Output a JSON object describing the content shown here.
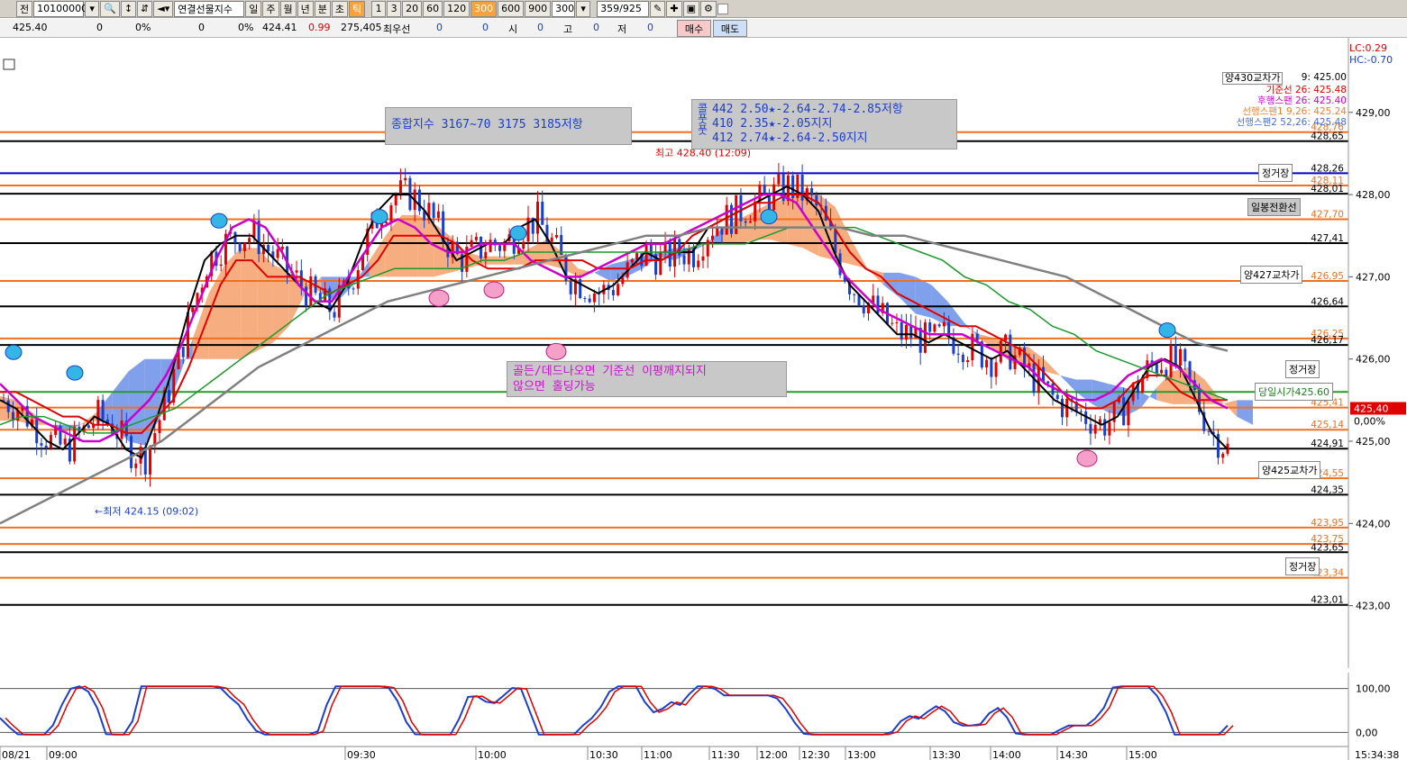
{
  "toolbar": {
    "code_label": "전",
    "code_value": "10100000",
    "product_name": "연결선물지수",
    "period_buttons": [
      "일",
      "주",
      "월",
      "년",
      "분",
      "초",
      "틱"
    ],
    "active_period": "틱",
    "interval_buttons": [
      "1",
      "3",
      "20",
      "60",
      "120",
      "300",
      "600",
      "900"
    ],
    "active_interval": "300",
    "interval_value": "300",
    "page_counter": "359/925"
  },
  "info": {
    "price": "425.40",
    "v1": "0",
    "p1": "0%",
    "v2": "0",
    "p2": "0%",
    "v3": "424.41",
    "v4": "0.99",
    "volume": "275,405",
    "best_label": "최우선",
    "best_v1": "0",
    "best_v2": "0",
    "open_label": "시",
    "open_value": "0",
    "high_label": "고",
    "high_value": "0",
    "low_label": "저",
    "low_value": "0",
    "buy_label": "매수",
    "sell_label": "매도"
  },
  "corner": {
    "lc": "LC:0.29",
    "hc": "HC:-0.70"
  },
  "legend": {
    "title": "양430교차가",
    "items": [
      {
        "label": "9:",
        "value": "425.00",
        "color": "#000000"
      },
      {
        "label": "기준선 26:",
        "value": "425.48",
        "color": "#e00000"
      },
      {
        "label": "후행스팬 26:",
        "value": "425.40",
        "color": "#cc00cc"
      },
      {
        "label": "선행스팬1 9,26:",
        "value": "425.24",
        "color": "#f08030"
      },
      {
        "label": "선행스팬2 52,26:",
        "value": "425.48",
        "color": "#4a6fd8"
      }
    ]
  },
  "annotations": {
    "kospi": "종합지수 3167~70 3175 3185저항",
    "options_side": "콜풋풋",
    "options": [
      "442 2.50★-2.64-2.74-2.85저항",
      "410 2.35★-2.05지지",
      "412 2.74★-2.64-2.50지지"
    ],
    "cross_note": [
      "골든/데드나오면 기준선 이평깨지되지",
      "않으면 홀딩가능"
    ],
    "high_mark": "최고 428.40 (12:09)",
    "low_mark": "←최저 424.15 (09:02)"
  },
  "level_labels": {
    "jeong1": "정거장",
    "ilbong": "일봉전환선",
    "yang427": "양427교차가",
    "jeong2": "정거장",
    "dangil": "당일시가425.60",
    "yang425": "양425교차가",
    "jeong3": "정거장"
  },
  "colors": {
    "candle_up": "#e00000",
    "candle_down": "#1a3fd0",
    "tenkan": "#000000",
    "kijun": "#e00000",
    "chikou": "#cc00cc",
    "span1": "#f08030",
    "span2": "#4a6fd8",
    "ma_green": "#1a9a2a",
    "ma_gray": "#808080",
    "level_orange": "#f07020",
    "level_black": "#000000",
    "level_blue": "#0000cc",
    "level_green": "#2a9a2a"
  },
  "chart_data": {
    "type": "candlestick",
    "title": "연결선물지수",
    "ylim": [
      422.7,
      429.6
    ],
    "yticks": [
      423.0,
      424.0,
      425.0,
      426.0,
      427.0,
      428.0,
      429.0
    ],
    "ytick_labels": [
      "423,00",
      "424,00",
      "425,00",
      "426,00",
      "427,00",
      "428,00",
      "429,00"
    ],
    "xticks": [
      "08/21",
      "09:00",
      "09:30",
      "10:00",
      "10:30",
      "11:00",
      "11:30",
      "12:00",
      "12:30",
      "13:00",
      "13:30",
      "14:00",
      "14:30",
      "15:00"
    ],
    "time_label": "15:34:38",
    "pct_label": "0,00%",
    "current_price": 425.4,
    "current_price_label": "425,40",
    "high": 428.4,
    "low": 424.15,
    "levels": [
      {
        "price": 428.76,
        "label": "428,76",
        "color": "orange"
      },
      {
        "price": 428.65,
        "label": "428,65",
        "color": "black"
      },
      {
        "price": 428.26,
        "label": "428,26",
        "color": "blue"
      },
      {
        "price": 428.11,
        "label": "428,11",
        "color": "orange"
      },
      {
        "price": 428.01,
        "label": "428,01",
        "color": "black"
      },
      {
        "price": 427.7,
        "label": "427,70",
        "color": "orange"
      },
      {
        "price": 427.41,
        "label": "427,41",
        "color": "black"
      },
      {
        "price": 426.95,
        "label": "426,95",
        "color": "orange"
      },
      {
        "price": 426.64,
        "label": "426,64",
        "color": "black"
      },
      {
        "price": 426.25,
        "label": "426,25",
        "color": "orange"
      },
      {
        "price": 426.17,
        "label": "426,17",
        "color": "black"
      },
      {
        "price": 425.6,
        "label": "",
        "color": "green"
      },
      {
        "price": 425.41,
        "label": "425,41",
        "color": "orange"
      },
      {
        "price": 425.14,
        "label": "425,14",
        "color": "orange"
      },
      {
        "price": 424.91,
        "label": "424,91",
        "color": "black"
      },
      {
        "price": 424.55,
        "label": "424,55",
        "color": "orange"
      },
      {
        "price": 424.35,
        "label": "424,35",
        "color": "black"
      },
      {
        "price": 423.95,
        "label": "423,95",
        "color": "orange"
      },
      {
        "price": 423.75,
        "label": "423,75",
        "color": "orange"
      },
      {
        "price": 423.65,
        "label": "423,65",
        "color": "black"
      },
      {
        "price": 423.34,
        "label": "423,34",
        "color": "orange"
      },
      {
        "price": 423.01,
        "label": "423,01",
        "color": "black"
      }
    ],
    "series": [
      {
        "name": "9",
        "key": "tenkan",
        "values": [
          425.5,
          425.4,
          425.2,
          425.0,
          424.9,
          425.1,
          425.3,
          425.2,
          424.9,
          424.8,
          425.3,
          425.9,
          426.6,
          427.2,
          427.4,
          427.5,
          427.5,
          427.3,
          427.1,
          426.9,
          426.7,
          426.6,
          426.9,
          427.4,
          427.8,
          428.0,
          428.0,
          427.8,
          427.5,
          427.2,
          427.3,
          427.4,
          427.4,
          427.6,
          427.7,
          427.4,
          427.0,
          426.9,
          426.8,
          426.9,
          427.1,
          427.3,
          427.2,
          427.3,
          427.3,
          427.6,
          427.7,
          427.8,
          427.9,
          428.0,
          428.1,
          428.0,
          427.8,
          427.3,
          426.9,
          426.7,
          426.5,
          426.3,
          426.3,
          426.2,
          426.3,
          426.2,
          426.1,
          426.0,
          426.1,
          425.9,
          425.7,
          425.5,
          425.4,
          425.3,
          425.2,
          425.3,
          425.6,
          425.9,
          426.0,
          425.9,
          425.5,
          425.1,
          424.9
        ]
      },
      {
        "name": "기준선 26",
        "key": "kijun",
        "values": [
          425.6,
          425.6,
          425.5,
          425.4,
          425.3,
          425.3,
          425.2,
          425.2,
          425.1,
          425.1,
          425.3,
          425.5,
          425.9,
          426.4,
          426.9,
          427.2,
          427.2,
          427.0,
          427.0,
          427.0,
          426.9,
          426.8,
          426.9,
          427.0,
          427.2,
          427.5,
          427.5,
          427.5,
          427.5,
          427.4,
          427.2,
          427.1,
          427.1,
          427.1,
          427.2,
          427.2,
          427.2,
          427.2,
          427.1,
          427.1,
          427.1,
          427.2,
          427.2,
          427.3,
          427.5,
          427.6,
          427.7,
          427.8,
          427.9,
          427.9,
          428.0,
          428.0,
          427.9,
          427.6,
          427.3,
          427.1,
          427.0,
          426.8,
          426.7,
          426.6,
          426.5,
          426.4,
          426.4,
          426.3,
          426.2,
          426.1,
          425.9,
          425.7,
          425.5,
          425.4,
          425.4,
          425.5,
          425.7,
          425.8,
          425.8,
          425.6,
          425.5,
          425.5,
          425.5
        ]
      },
      {
        "name": "후행스팬 26",
        "key": "chikou",
        "values": [
          425.7,
          425.5,
          425.3,
          425.2,
          425.1,
          425.0,
          425.0,
          425.1,
          425.3,
          425.5,
          425.8,
          426.2,
          426.7,
          427.2,
          427.6,
          427.7,
          427.6,
          427.3,
          426.9,
          426.7,
          426.7,
          427.0,
          427.3,
          427.6,
          427.7,
          427.6,
          427.4,
          427.3,
          427.3,
          427.4,
          427.4,
          427.4,
          427.2,
          427.1,
          427.0,
          427.0,
          427.1,
          427.2,
          427.3,
          427.4,
          427.4,
          427.5,
          427.6,
          427.7,
          427.8,
          427.9,
          428.0,
          428.0,
          427.9,
          427.6,
          427.3,
          427.0,
          426.8,
          426.6,
          426.5,
          426.4,
          426.3,
          426.3,
          426.3,
          426.2,
          426.1,
          426.0,
          425.9,
          425.7,
          425.6,
          425.5,
          425.5,
          425.6,
          425.8,
          425.9,
          426.0,
          425.9,
          425.7,
          425.5,
          425.4
        ]
      },
      {
        "name": "MA_green",
        "key": "ma_green",
        "values": [
          425.2,
          425.3,
          425.3,
          425.2,
          425.1,
          425.1,
          425.2,
          425.3,
          425.4,
          425.6,
          425.8,
          426.0,
          426.2,
          426.4,
          426.6,
          426.8,
          426.9,
          427.0,
          427.1,
          427.1,
          427.1,
          427.1,
          427.2,
          427.2,
          427.3,
          427.3,
          427.3,
          427.3,
          427.3,
          427.3,
          427.3,
          427.3,
          427.4,
          427.4,
          427.4,
          427.5,
          427.6,
          427.6,
          427.6,
          427.6,
          427.5,
          427.4,
          427.3,
          427.2,
          427.0,
          426.9,
          426.7,
          426.6,
          426.4,
          426.3,
          426.1,
          426.0,
          425.9,
          425.8,
          425.7,
          425.6,
          425.5
        ]
      },
      {
        "name": "MA_gray",
        "key": "ma_gray",
        "values": [
          424.0,
          424.2,
          424.4,
          424.6,
          424.8,
          425.0,
          425.3,
          425.6,
          425.9,
          426.1,
          426.3,
          426.5,
          426.7,
          426.8,
          426.9,
          427.0,
          427.1,
          427.2,
          427.3,
          427.4,
          427.5,
          427.5,
          427.6,
          427.6,
          427.6,
          427.6,
          427.6,
          427.5,
          427.5,
          427.4,
          427.3,
          427.2,
          427.1,
          427.0,
          426.8,
          426.6,
          426.4,
          426.2,
          426.1
        ]
      }
    ],
    "oscillator": {
      "ylim": [
        -30,
        130
      ],
      "yticks": [
        0,
        100
      ],
      "ytick_labels": [
        "0,00",
        "100,00"
      ]
    }
  }
}
